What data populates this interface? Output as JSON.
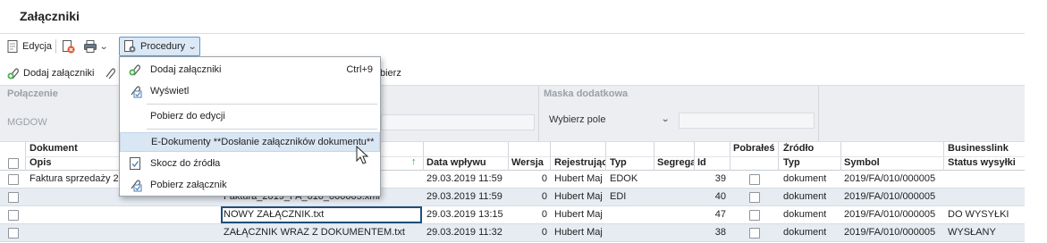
{
  "window": {
    "title": "Załączniki"
  },
  "toolbar": {
    "edit_label": "Edycja",
    "procedures_label": "Procedury"
  },
  "toolbar2": {
    "add_label": "Dodaj załączniki",
    "fetch_label_partial": "bierz"
  },
  "filters": {
    "connection_label": "Połączenie",
    "connection_value": "MGDOW",
    "extra_mask_label": "Maska dodatkowa",
    "select_field_label": "Wybierz pole"
  },
  "menu": {
    "items": [
      {
        "label": "Dodaj załączniki",
        "shortcut": "Ctrl+9",
        "icon": "add-attachment-icon"
      },
      {
        "label": "Wyświetl",
        "shortcut": "",
        "icon": "view-attachment-icon"
      },
      {
        "label": "Pobierz do edycji",
        "shortcut": "",
        "icon": ""
      },
      {
        "label": "E-Dokumenty **Dosłanie załączników dokumentu**",
        "shortcut": "",
        "icon": ""
      },
      {
        "label": "Skocz do źródła",
        "shortcut": "",
        "icon": "jump-source-icon"
      },
      {
        "label": "Pobierz załącznik",
        "shortcut": "",
        "icon": "download-attachment-icon"
      }
    ]
  },
  "grid": {
    "headers_top": {
      "dokument": "Dokument",
      "pobrales": "Pobrałeś",
      "zrodlo": "Źródło",
      "businesslink": "Businesslink"
    },
    "headers": {
      "opis": "Opis",
      "data_wplywu": "Data wpływu",
      "wersja": "Wersja",
      "rejestrujacy": "Rejestrując",
      "typ": "Typ",
      "segregator": "Segrega",
      "id": "Id",
      "typ2": "Typ",
      "symbol": "Symbol",
      "status": "Status wysyłki"
    },
    "rows": [
      {
        "opis": "Faktura sprzedaży 20",
        "nazwa": "",
        "data": "29.03.2019 11:59",
        "wersja": "0",
        "rej": "Hubert Maj",
        "typ": "EDOK",
        "id": "39",
        "typ2": "dokument",
        "symbol": "2019/FA/010/000005",
        "status": ""
      },
      {
        "opis": "",
        "nazwa": "Faktura_2019_FA_010_000005.xml",
        "data": "29.03.2019 11:59",
        "wersja": "0",
        "rej": "Hubert Maj",
        "typ": "EDI",
        "id": "40",
        "typ2": "dokument",
        "symbol": "2019/FA/010/000005",
        "status": ""
      },
      {
        "opis": "",
        "nazwa": "NOWY ZAŁĄCZNIK.txt",
        "data": "29.03.2019 13:15",
        "wersja": "0",
        "rej": "Hubert Maj",
        "typ": "",
        "id": "47",
        "typ2": "dokument",
        "symbol": "2019/FA/010/000005",
        "status": "DO WYSYŁKI"
      },
      {
        "opis": "",
        "nazwa": "ZAŁĄCZNIK WRAZ Z DOKUMENTEM.txt",
        "data": "29.03.2019 11:32",
        "wersja": "0",
        "rej": "Hubert Maj",
        "typ": "",
        "id": "38",
        "typ2": "dokument",
        "symbol": "2019/FA/010/000005",
        "status": "WYSŁANY"
      }
    ]
  }
}
